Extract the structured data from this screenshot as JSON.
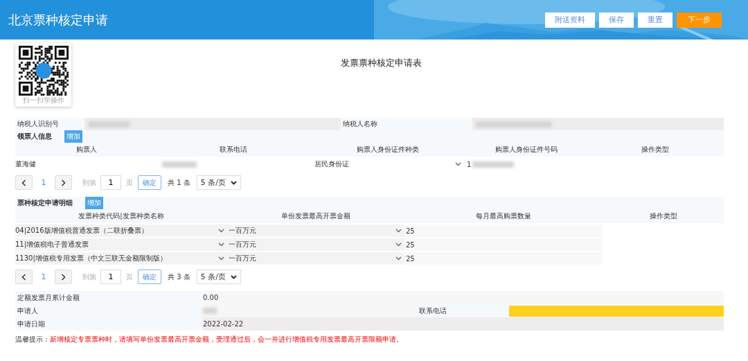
{
  "header": {
    "title": "北京票种核定申请",
    "buttons": [
      {
        "label": "附送资料",
        "kind": "plain"
      },
      {
        "label": "保存",
        "kind": "plain"
      },
      {
        "label": "重置",
        "kind": "plain"
      },
      {
        "label": "下一步",
        "kind": "primary"
      }
    ]
  },
  "qr": {
    "caption": "扫一扫学操作"
  },
  "form_title": "发票票种核定申请表",
  "taxpayer": {
    "id_label": "纳税人识别号",
    "name_label": "纳税人名称"
  },
  "buyers": {
    "title": "领票人信息",
    "add": "增加",
    "columns": [
      "购票人",
      "联系电话",
      "购票人身份证件种类",
      "购票人身份证件号码",
      "操作类型"
    ],
    "rows": [
      {
        "name": "董海健",
        "id_type": "居民身份证",
        "id_number": "1"
      }
    ],
    "pager": {
      "page": "1",
      "goto": "到第",
      "input": "1",
      "unit": "页",
      "confirm": "确定",
      "total": "共 1 条",
      "size": "5 条/页"
    }
  },
  "details": {
    "title": "票种核定申请明细",
    "add": "增加",
    "columns": [
      "发票种类代码|发票种类名称",
      "单份发票最高开票金额",
      "每月最高购票数量",
      "操作类型"
    ],
    "rows": [
      {
        "type": "04|2016版增值税普通发票（二联折叠票）",
        "amount": "一百万元",
        "count": "25"
      },
      {
        "type": "11|增值税电子普通发票",
        "amount": "一百万元",
        "count": "25"
      },
      {
        "type": "1130|增值税专用发票（中文三联无金额限制版）",
        "amount": "一百万元",
        "count": "25"
      }
    ],
    "pager": {
      "page": "1",
      "goto": "到第",
      "input": "1",
      "unit": "页",
      "confirm": "确定",
      "total": "共 3 条",
      "size": "5 条/页"
    }
  },
  "summary": {
    "quota_label": "定额发票月累计金额",
    "quota_value": "0.00",
    "applicant_label": "申请人",
    "phone_label": "联系电话",
    "phone_highlighted": true,
    "date_label": "申请日期",
    "date_value": "2022-02-22"
  },
  "tip": {
    "label": "温馨提示：",
    "text": "新增核定专票票种时，请填写单份发票最高开票金额，受理通过后，会一并进行增值税专用发票最高开票限额申请。"
  }
}
